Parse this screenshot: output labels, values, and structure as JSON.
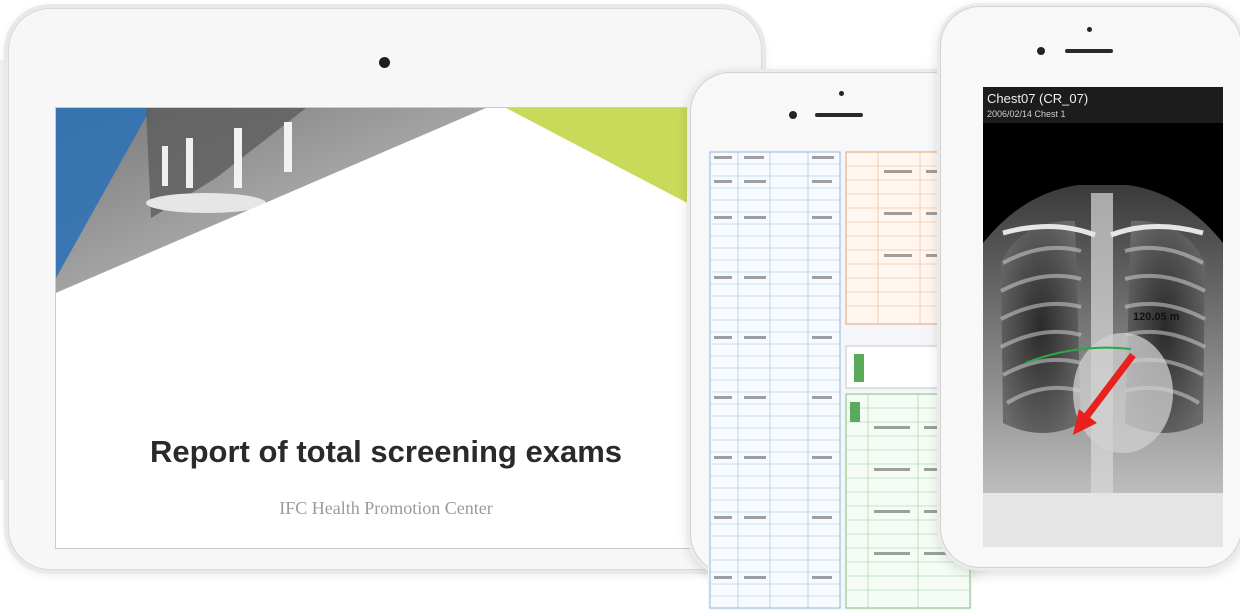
{
  "ipad": {
    "report_title": "Report of total screening exams",
    "report_subtitle": "IFC Health Promotion Center"
  },
  "viewer": {
    "title": "Chest07 (CR_07)",
    "subtitle": "2006/02/14  Chest 1",
    "measurement": "120.05 m"
  },
  "colors": {
    "accent_green": "#c9d95a",
    "accent_blue": "#2f72b5",
    "arrow_red": "#e8201e",
    "measure_green": "#2aa84a"
  }
}
